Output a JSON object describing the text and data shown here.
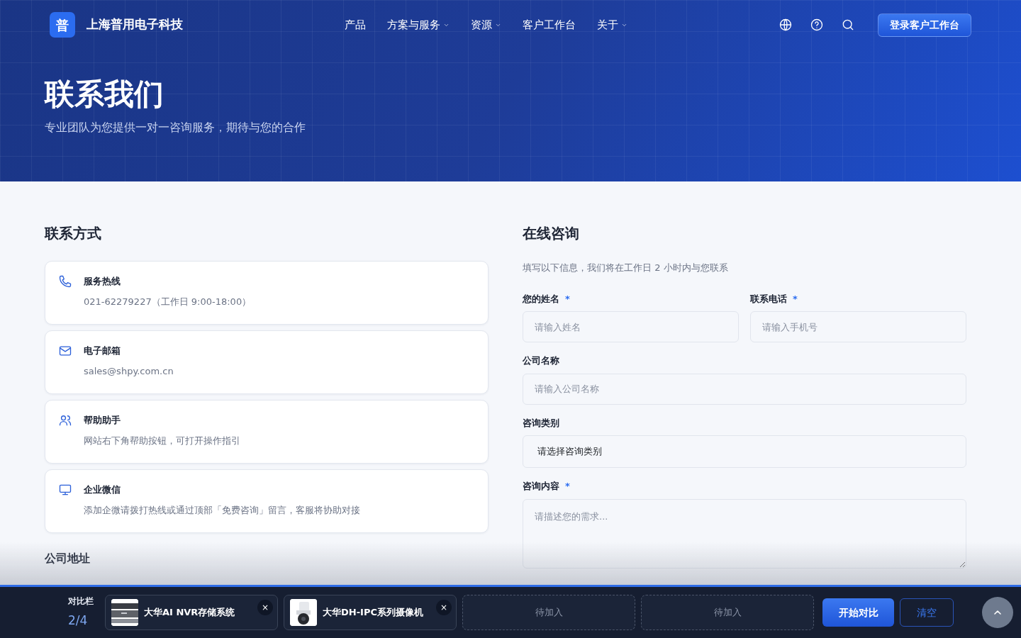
{
  "header": {
    "logo_mark": "普",
    "brand": "上海普用电子科技",
    "nav": [
      {
        "label": "产品",
        "has_menu": false
      },
      {
        "label": "方案与服务",
        "has_menu": true
      },
      {
        "label": "资源",
        "has_menu": true
      },
      {
        "label": "客户工作台",
        "has_menu": false
      },
      {
        "label": "关于",
        "has_menu": true
      }
    ],
    "login_button": "登录客户工作台"
  },
  "hero": {
    "title": "联系我们",
    "subtitle": "专业团队为您提供一对一咨询服务，期待与您的合作"
  },
  "contact": {
    "heading": "联系方式",
    "items": [
      {
        "kind": "phone",
        "title": "服务热线",
        "detail": "021-62279227（工作日 9:00-18:00）"
      },
      {
        "kind": "mail",
        "title": "电子邮箱",
        "detail": "sales@shpy.com.cn"
      },
      {
        "kind": "people",
        "title": "帮助助手",
        "detail": "网站右下角帮助按钮，可打开操作指引"
      },
      {
        "kind": "monitor",
        "title": "企业微信",
        "detail": "添加企微请拨打热线或通过顶部「免费咨询」留言，客服将协助对接"
      }
    ],
    "address_heading": "公司地址"
  },
  "form": {
    "heading": "在线咨询",
    "intro": "填写以下信息，我们将在工作日 2 小时内与您联系",
    "required_mark": "*",
    "fields": [
      {
        "kind": "input",
        "label": "您的姓名",
        "required": true,
        "placeholder": "请输入姓名",
        "half": true
      },
      {
        "kind": "input",
        "label": "联系电话",
        "required": true,
        "placeholder": "请输入手机号",
        "half": true
      },
      {
        "kind": "input",
        "label": "公司名称",
        "required": false,
        "placeholder": "请输入公司名称",
        "half": false
      },
      {
        "kind": "select",
        "label": "咨询类别",
        "required": false,
        "value": "请选择咨询类别",
        "half": false
      },
      {
        "kind": "textarea",
        "label": "咨询内容",
        "required": true,
        "placeholder": "请描述您的需求...",
        "half": false
      }
    ]
  },
  "compare_bar": {
    "title": "对比栏",
    "count": "2/4",
    "slots": [
      {
        "kind": "item",
        "name": "大华AI NVR存储系统",
        "remove": "×"
      },
      {
        "kind": "item",
        "name": "大华DH-IPC系列摄像机",
        "remove": "×"
      },
      {
        "kind": "empty",
        "name": "待加入"
      },
      {
        "kind": "empty",
        "name": "待加入"
      }
    ],
    "start_button": "开始对比",
    "clear_button": "清空"
  }
}
